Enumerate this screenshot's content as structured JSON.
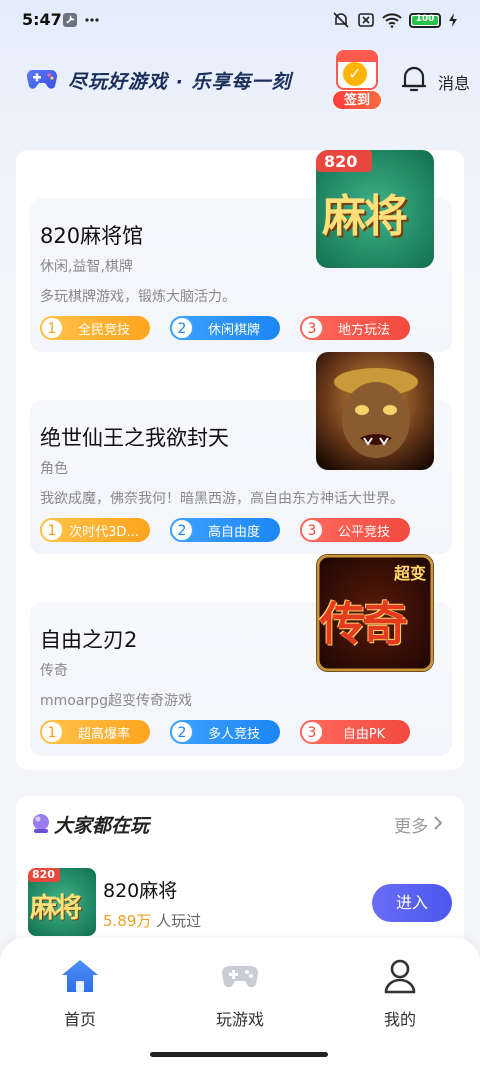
{
  "status": {
    "time": "5:47",
    "battery": "100",
    "battery_level": 1.0
  },
  "header": {
    "slogan": "尽玩好游戏 · 乐享每一刻",
    "checkin_label": "签到",
    "messages_label": "消息"
  },
  "games": [
    {
      "name": "820麻将馆",
      "category": "休闲,益智,棋牌",
      "description": "多玩棋牌游戏，锻炼大脑活力。",
      "thumb_text": "麻将",
      "thumb_badge": "820",
      "tags": [
        {
          "num": "1",
          "label": "全民竞技"
        },
        {
          "num": "2",
          "label": "休闲棋牌"
        },
        {
          "num": "3",
          "label": "地方玩法"
        }
      ]
    },
    {
      "name": "绝世仙王之我欲封天",
      "category": "角色",
      "description": "我欲成魔，佛奈我何！暗黑西游，高自由东方神话大世界。",
      "tags": [
        {
          "num": "1",
          "label": "次时代3D..."
        },
        {
          "num": "2",
          "label": "高自由度"
        },
        {
          "num": "3",
          "label": "公平竞技"
        }
      ]
    },
    {
      "name": "自由之刃2",
      "category": "传奇",
      "description": "mmoarpg超变传奇游戏",
      "thumb_text": "传奇",
      "thumb_badge": "超变",
      "tags": [
        {
          "num": "1",
          "label": "超高爆率"
        },
        {
          "num": "2",
          "label": "多人竞技"
        },
        {
          "num": "3",
          "label": "自由PK"
        }
      ]
    }
  ],
  "popular": {
    "title": "大家都在玩",
    "more_label": "更多",
    "item": {
      "name": "820麻将",
      "count": "5.89万",
      "count_suffix": " 人玩过",
      "thumb_text": "麻将",
      "thumb_badge": "820",
      "button": "进入"
    }
  },
  "nav": [
    {
      "label": "首页",
      "icon": "home-icon",
      "active": true
    },
    {
      "label": "玩游戏",
      "icon": "gamepad-icon",
      "active": false
    },
    {
      "label": "我的",
      "icon": "user-icon",
      "active": false
    }
  ],
  "colors": {
    "accent": "#3b7df5",
    "enter_button": "#5a5ff2",
    "count_highlight": "#e6a327"
  }
}
